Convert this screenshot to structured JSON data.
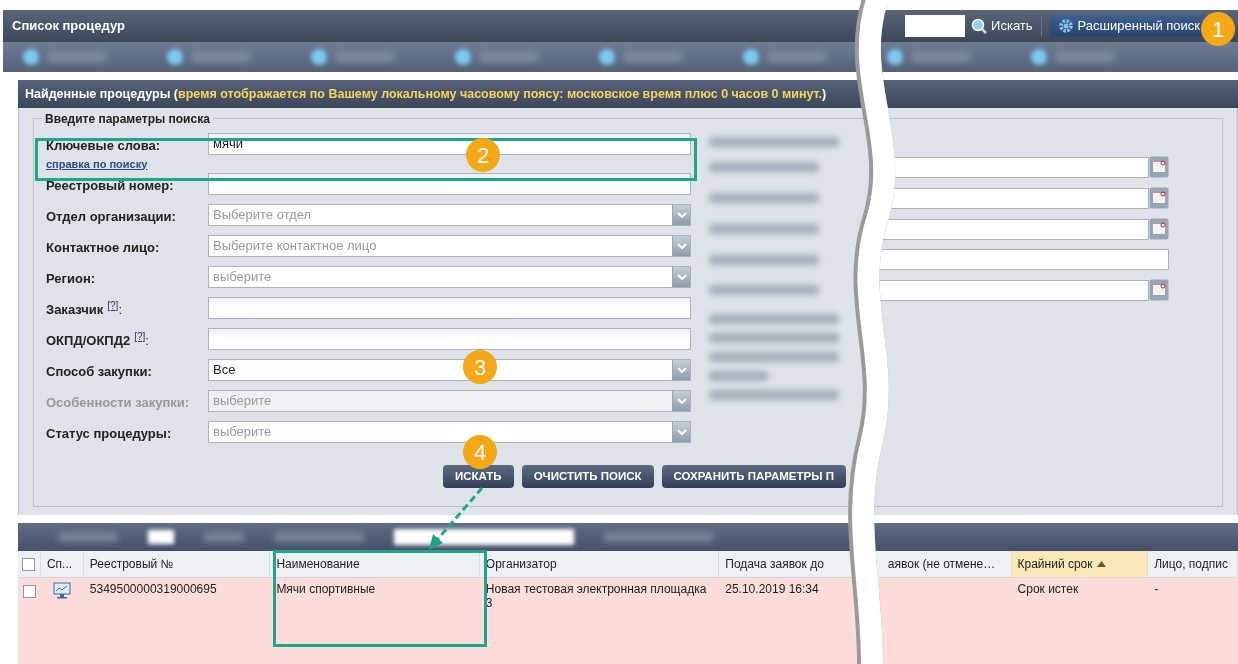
{
  "header": {
    "title": "Список процедур",
    "search_button": "Искать",
    "advanced_button": "Расширенный поиск"
  },
  "results_panel": {
    "title": "Найденные процедуры (",
    "note": "время отображается по Вашему локальному часовому поясу: московское время плюс 0 часов 0 минут.",
    "close": ")"
  },
  "form": {
    "legend": "Введите параметры поиска",
    "fields": [
      {
        "kind": "text",
        "label": "Ключевые слова:",
        "value": "мячи",
        "link": "справка по поиску",
        "disabled": false
      },
      {
        "kind": "text",
        "label": "Реестровый номер:",
        "disabled": false
      },
      {
        "kind": "select",
        "label": "Отдел организации:",
        "placeholder": "Выберите отдел",
        "disabled": false
      },
      {
        "kind": "select",
        "label": "Контактное лицо:",
        "placeholder": "Выберите контактное лицо",
        "disabled": false
      },
      {
        "kind": "select",
        "label": "Регион:",
        "placeholder": "выберите",
        "disabled": false
      },
      {
        "kind": "text",
        "label": "Заказчик",
        "help": "[?]",
        "suffix": ":",
        "disabled": false
      },
      {
        "kind": "text",
        "label": "ОКПД/ОКПД2",
        "help": "[?]",
        "suffix": ":",
        "disabled": false
      },
      {
        "kind": "select",
        "label": "Способ закупки:",
        "value": "Все",
        "disabled": false
      },
      {
        "kind": "select",
        "label": "Особенности закупки:",
        "placeholder": "выберите",
        "disabled": true
      },
      {
        "kind": "select",
        "label": "Статус процедуры:",
        "placeholder": "выберите",
        "disabled": false
      }
    ],
    "right_fields": [
      {
        "kind": "date"
      },
      {
        "kind": "date"
      },
      {
        "kind": "date"
      },
      {
        "kind": "text"
      },
      {
        "kind": "date"
      }
    ],
    "buttons": [
      "ИСКАТЬ",
      "ОЧИСТИТЬ ПОИСК",
      "СОХРАНИТЬ ПАРАМЕТРЫ П"
    ]
  },
  "table": {
    "select_all": {
      "checked": false
    },
    "columns": [
      {
        "label": "Сп...",
        "sorted": false
      },
      {
        "label": "Реестровый №",
        "sorted": false
      },
      {
        "label": "Наименование",
        "sorted": false
      },
      {
        "label": "Организатор",
        "sorted": false
      },
      {
        "label": "Подача заявок до",
        "sorted": false
      },
      {
        "label": "аявок (не отмене…",
        "sorted": false
      },
      {
        "label": "Крайний срок",
        "sorted": true
      },
      {
        "label": "Лицо, подпис",
        "sorted": false
      }
    ],
    "rows": [
      {
        "checked": false,
        "cells": [
          "",
          "5349500000319000695",
          "Мячи спортивные",
          "Новая тестовая электронная площадка 3",
          "25.10.2019 16:34",
          "",
          "Срок истек",
          "-"
        ]
      }
    ]
  },
  "callouts": [
    "1",
    "2",
    "3",
    "4"
  ]
}
